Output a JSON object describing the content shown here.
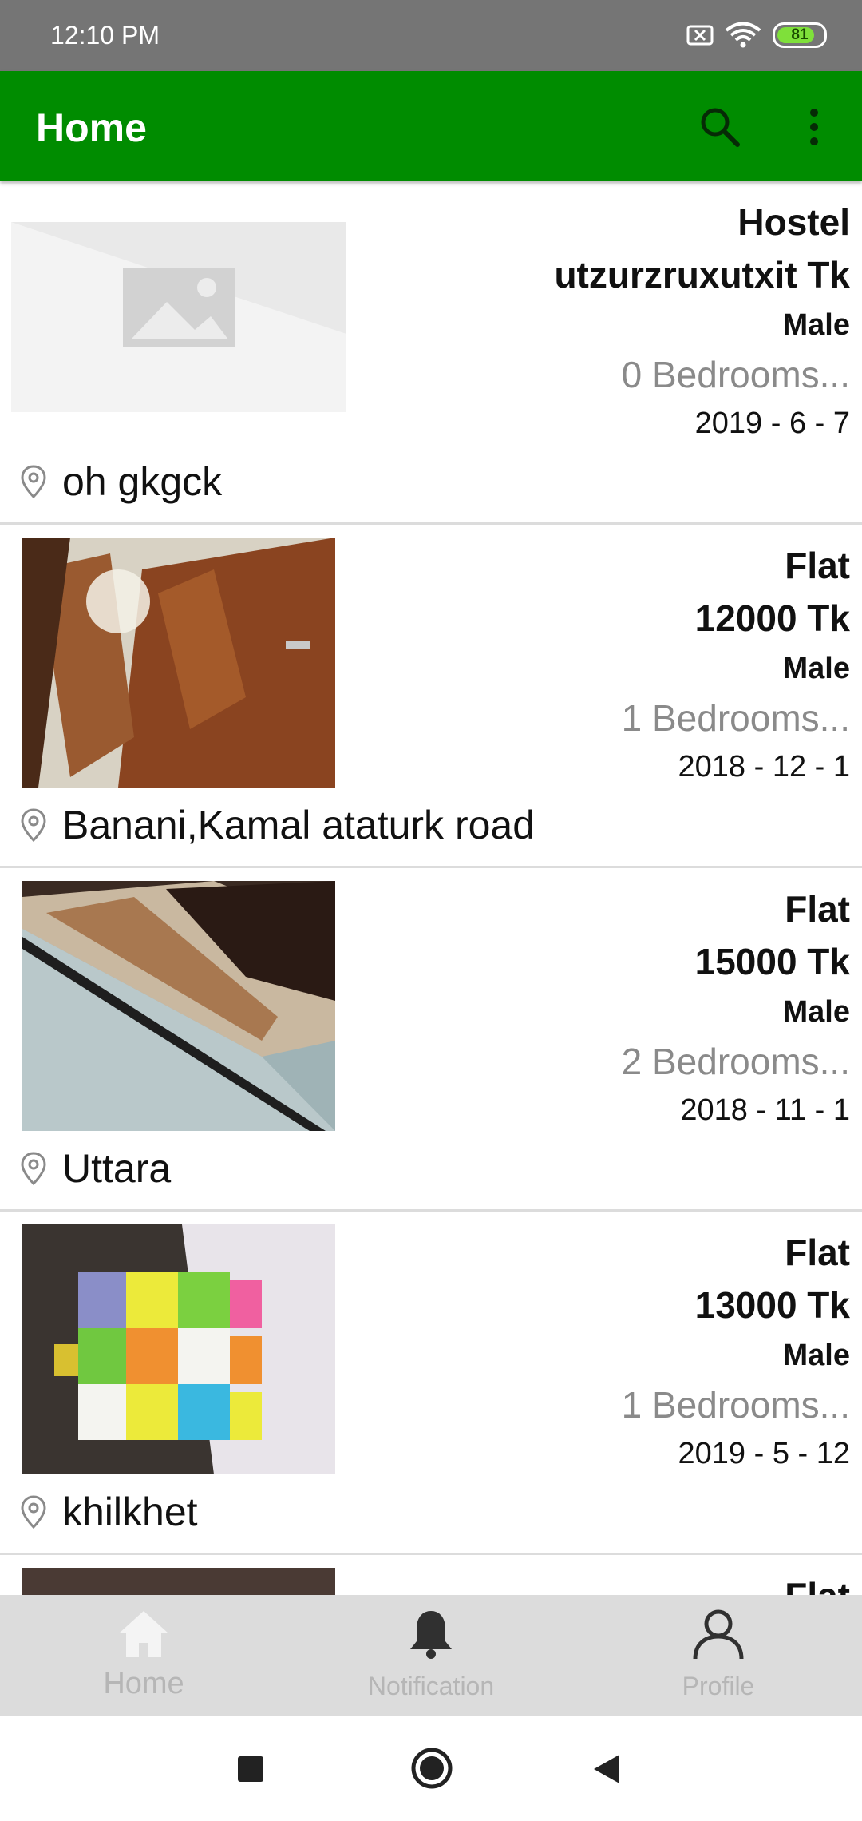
{
  "status_bar": {
    "time": "12:10 PM",
    "battery": "81"
  },
  "app_bar": {
    "title": "Home"
  },
  "listings": [
    {
      "type": "Hostel",
      "price": "utzurzruxutxit Tk",
      "gender": "Male",
      "bedrooms": "0 Bedrooms...",
      "date": "2019 - 6 - 7",
      "location": "oh gkgck",
      "image": "placeholder"
    },
    {
      "type": "Flat",
      "price": "12000 Tk",
      "gender": "Male",
      "bedrooms": "1 Bedrooms...",
      "date": "2018 - 12 - 1",
      "location": "Banani,Kamal ataturk road",
      "image": "door-photo"
    },
    {
      "type": "Flat",
      "price": "15000 Tk",
      "gender": "Male",
      "bedrooms": "2 Bedrooms...",
      "date": "2018 - 11 - 1",
      "location": "Uttara",
      "image": "wall-photo"
    },
    {
      "type": "Flat",
      "price": "13000 Tk",
      "gender": "Male",
      "bedrooms": "1 Bedrooms...",
      "date": "2019 - 5 - 12",
      "location": "khilkhet",
      "image": "cube-photo"
    },
    {
      "type": "Flat"
    }
  ],
  "bottom_nav": [
    {
      "label": "Home",
      "icon": "home-icon"
    },
    {
      "label": "Notification",
      "icon": "bell-icon"
    },
    {
      "label": "Profile",
      "icon": "person-icon"
    }
  ],
  "colors": {
    "app_bar": "#008c00",
    "status_bar": "#757575",
    "nav_bg": "#dcdcdc",
    "nav_inactive": "#b6b6b6"
  }
}
